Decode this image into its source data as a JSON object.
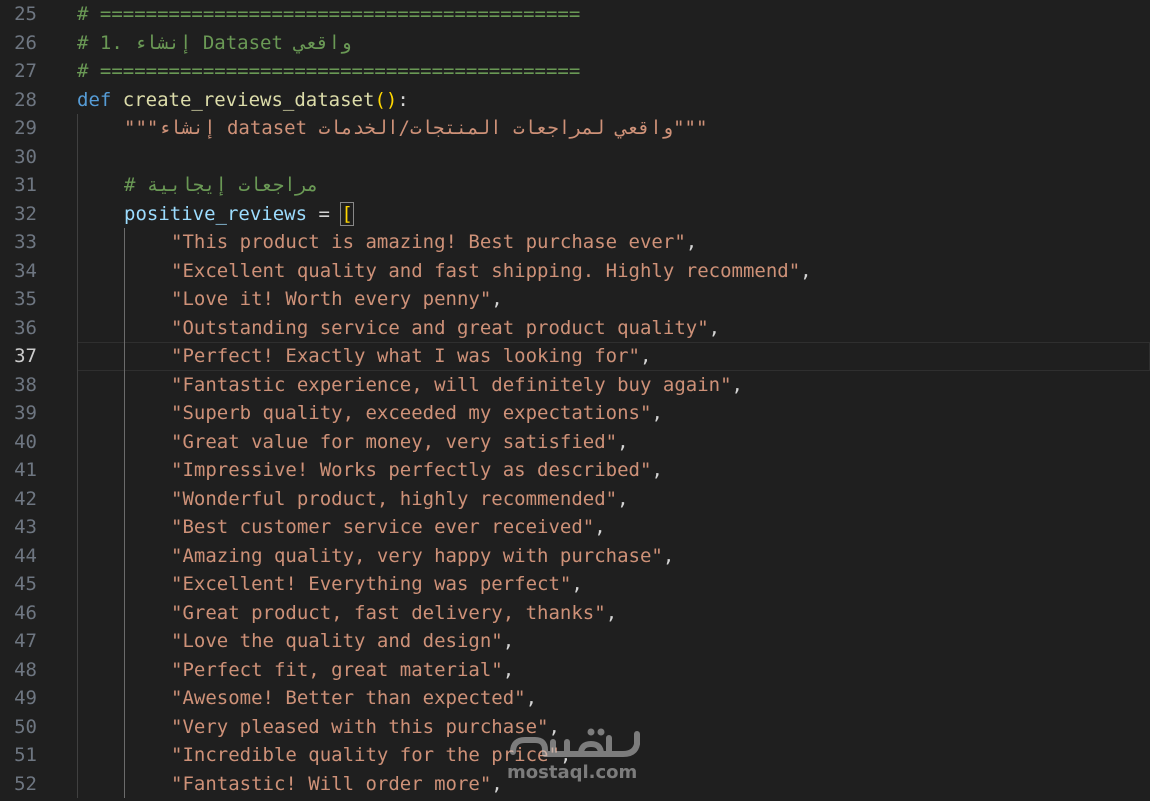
{
  "colors": {
    "background": "#1f1f1f",
    "line_number": "#6e7681",
    "line_number_active": "#cccccc",
    "comment": "#6a9955",
    "keyword": "#569cd6",
    "function": "#dcdcaa",
    "variable": "#9cdcfe",
    "string": "#ce9178",
    "bracket": "#ffd700",
    "punctuation": "#d4d4d4"
  },
  "editor": {
    "current_line": 37,
    "lines": [
      {
        "num": 25,
        "indent": 0,
        "tokens": [
          {
            "t": "comment",
            "v": "# =========================================="
          }
        ]
      },
      {
        "num": 26,
        "indent": 0,
        "tokens": [
          {
            "t": "comment",
            "v": "# 1. إنشاء Dataset واقعي"
          }
        ]
      },
      {
        "num": 27,
        "indent": 0,
        "tokens": [
          {
            "t": "comment",
            "v": "# =========================================="
          }
        ]
      },
      {
        "num": 28,
        "indent": 0,
        "tokens": [
          {
            "t": "keyword",
            "v": "def"
          },
          {
            "t": "punct",
            "v": " "
          },
          {
            "t": "func",
            "v": "create_reviews_dataset"
          },
          {
            "t": "paren",
            "v": "()"
          },
          {
            "t": "punct",
            "v": ":"
          }
        ]
      },
      {
        "num": 29,
        "indent": 1,
        "tokens": [
          {
            "t": "string",
            "v": "\"\"\"إنشاء dataset واقعي لمراجعات المنتجات/الخدمات\"\"\""
          }
        ]
      },
      {
        "num": 30,
        "indent": 1,
        "tokens": []
      },
      {
        "num": 31,
        "indent": 1,
        "tokens": [
          {
            "t": "comment",
            "v": "# مراجعات إيجابية"
          }
        ]
      },
      {
        "num": 32,
        "indent": 1,
        "tokens": [
          {
            "t": "var",
            "v": "positive_reviews"
          },
          {
            "t": "punct",
            "v": " = "
          },
          {
            "t": "bracket",
            "v": "["
          }
        ]
      },
      {
        "num": 33,
        "indent": 2,
        "tokens": [
          {
            "t": "string",
            "v": "\"This product is amazing! Best purchase ever\""
          },
          {
            "t": "punct",
            "v": ","
          }
        ]
      },
      {
        "num": 34,
        "indent": 2,
        "tokens": [
          {
            "t": "string",
            "v": "\"Excellent quality and fast shipping. Highly recommend\""
          },
          {
            "t": "punct",
            "v": ","
          }
        ]
      },
      {
        "num": 35,
        "indent": 2,
        "tokens": [
          {
            "t": "string",
            "v": "\"Love it! Worth every penny\""
          },
          {
            "t": "punct",
            "v": ","
          }
        ]
      },
      {
        "num": 36,
        "indent": 2,
        "tokens": [
          {
            "t": "string",
            "v": "\"Outstanding service and great product quality\""
          },
          {
            "t": "punct",
            "v": ","
          }
        ]
      },
      {
        "num": 37,
        "indent": 2,
        "tokens": [
          {
            "t": "string",
            "v": "\"Perfect! Exactly what I was looking for\""
          },
          {
            "t": "punct",
            "v": ","
          }
        ]
      },
      {
        "num": 38,
        "indent": 2,
        "tokens": [
          {
            "t": "string",
            "v": "\"Fantastic experience, will definitely buy again\""
          },
          {
            "t": "punct",
            "v": ","
          }
        ]
      },
      {
        "num": 39,
        "indent": 2,
        "tokens": [
          {
            "t": "string",
            "v": "\"Superb quality, exceeded my expectations\""
          },
          {
            "t": "punct",
            "v": ","
          }
        ]
      },
      {
        "num": 40,
        "indent": 2,
        "tokens": [
          {
            "t": "string",
            "v": "\"Great value for money, very satisfied\""
          },
          {
            "t": "punct",
            "v": ","
          }
        ]
      },
      {
        "num": 41,
        "indent": 2,
        "tokens": [
          {
            "t": "string",
            "v": "\"Impressive! Works perfectly as described\""
          },
          {
            "t": "punct",
            "v": ","
          }
        ]
      },
      {
        "num": 42,
        "indent": 2,
        "tokens": [
          {
            "t": "string",
            "v": "\"Wonderful product, highly recommended\""
          },
          {
            "t": "punct",
            "v": ","
          }
        ]
      },
      {
        "num": 43,
        "indent": 2,
        "tokens": [
          {
            "t": "string",
            "v": "\"Best customer service ever received\""
          },
          {
            "t": "punct",
            "v": ","
          }
        ]
      },
      {
        "num": 44,
        "indent": 2,
        "tokens": [
          {
            "t": "string",
            "v": "\"Amazing quality, very happy with purchase\""
          },
          {
            "t": "punct",
            "v": ","
          }
        ]
      },
      {
        "num": 45,
        "indent": 2,
        "tokens": [
          {
            "t": "string",
            "v": "\"Excellent! Everything was perfect\""
          },
          {
            "t": "punct",
            "v": ","
          }
        ]
      },
      {
        "num": 46,
        "indent": 2,
        "tokens": [
          {
            "t": "string",
            "v": "\"Great product, fast delivery, thanks\""
          },
          {
            "t": "punct",
            "v": ","
          }
        ]
      },
      {
        "num": 47,
        "indent": 2,
        "tokens": [
          {
            "t": "string",
            "v": "\"Love the quality and design\""
          },
          {
            "t": "punct",
            "v": ","
          }
        ]
      },
      {
        "num": 48,
        "indent": 2,
        "tokens": [
          {
            "t": "string",
            "v": "\"Perfect fit, great material\""
          },
          {
            "t": "punct",
            "v": ","
          }
        ]
      },
      {
        "num": 49,
        "indent": 2,
        "tokens": [
          {
            "t": "string",
            "v": "\"Awesome! Better than expected\""
          },
          {
            "t": "punct",
            "v": ","
          }
        ]
      },
      {
        "num": 50,
        "indent": 2,
        "tokens": [
          {
            "t": "string",
            "v": "\"Very pleased with this purchase\""
          },
          {
            "t": "punct",
            "v": ","
          }
        ]
      },
      {
        "num": 51,
        "indent": 2,
        "tokens": [
          {
            "t": "string",
            "v": "\"Incredible quality for the price\""
          },
          {
            "t": "punct",
            "v": ","
          }
        ]
      },
      {
        "num": 52,
        "indent": 2,
        "tokens": [
          {
            "t": "string",
            "v": "\"Fantastic! Will order more\""
          },
          {
            "t": "punct",
            "v": ","
          }
        ]
      }
    ]
  },
  "watermark": {
    "text": "mostaql.com",
    "logo_text": "مستقل"
  }
}
